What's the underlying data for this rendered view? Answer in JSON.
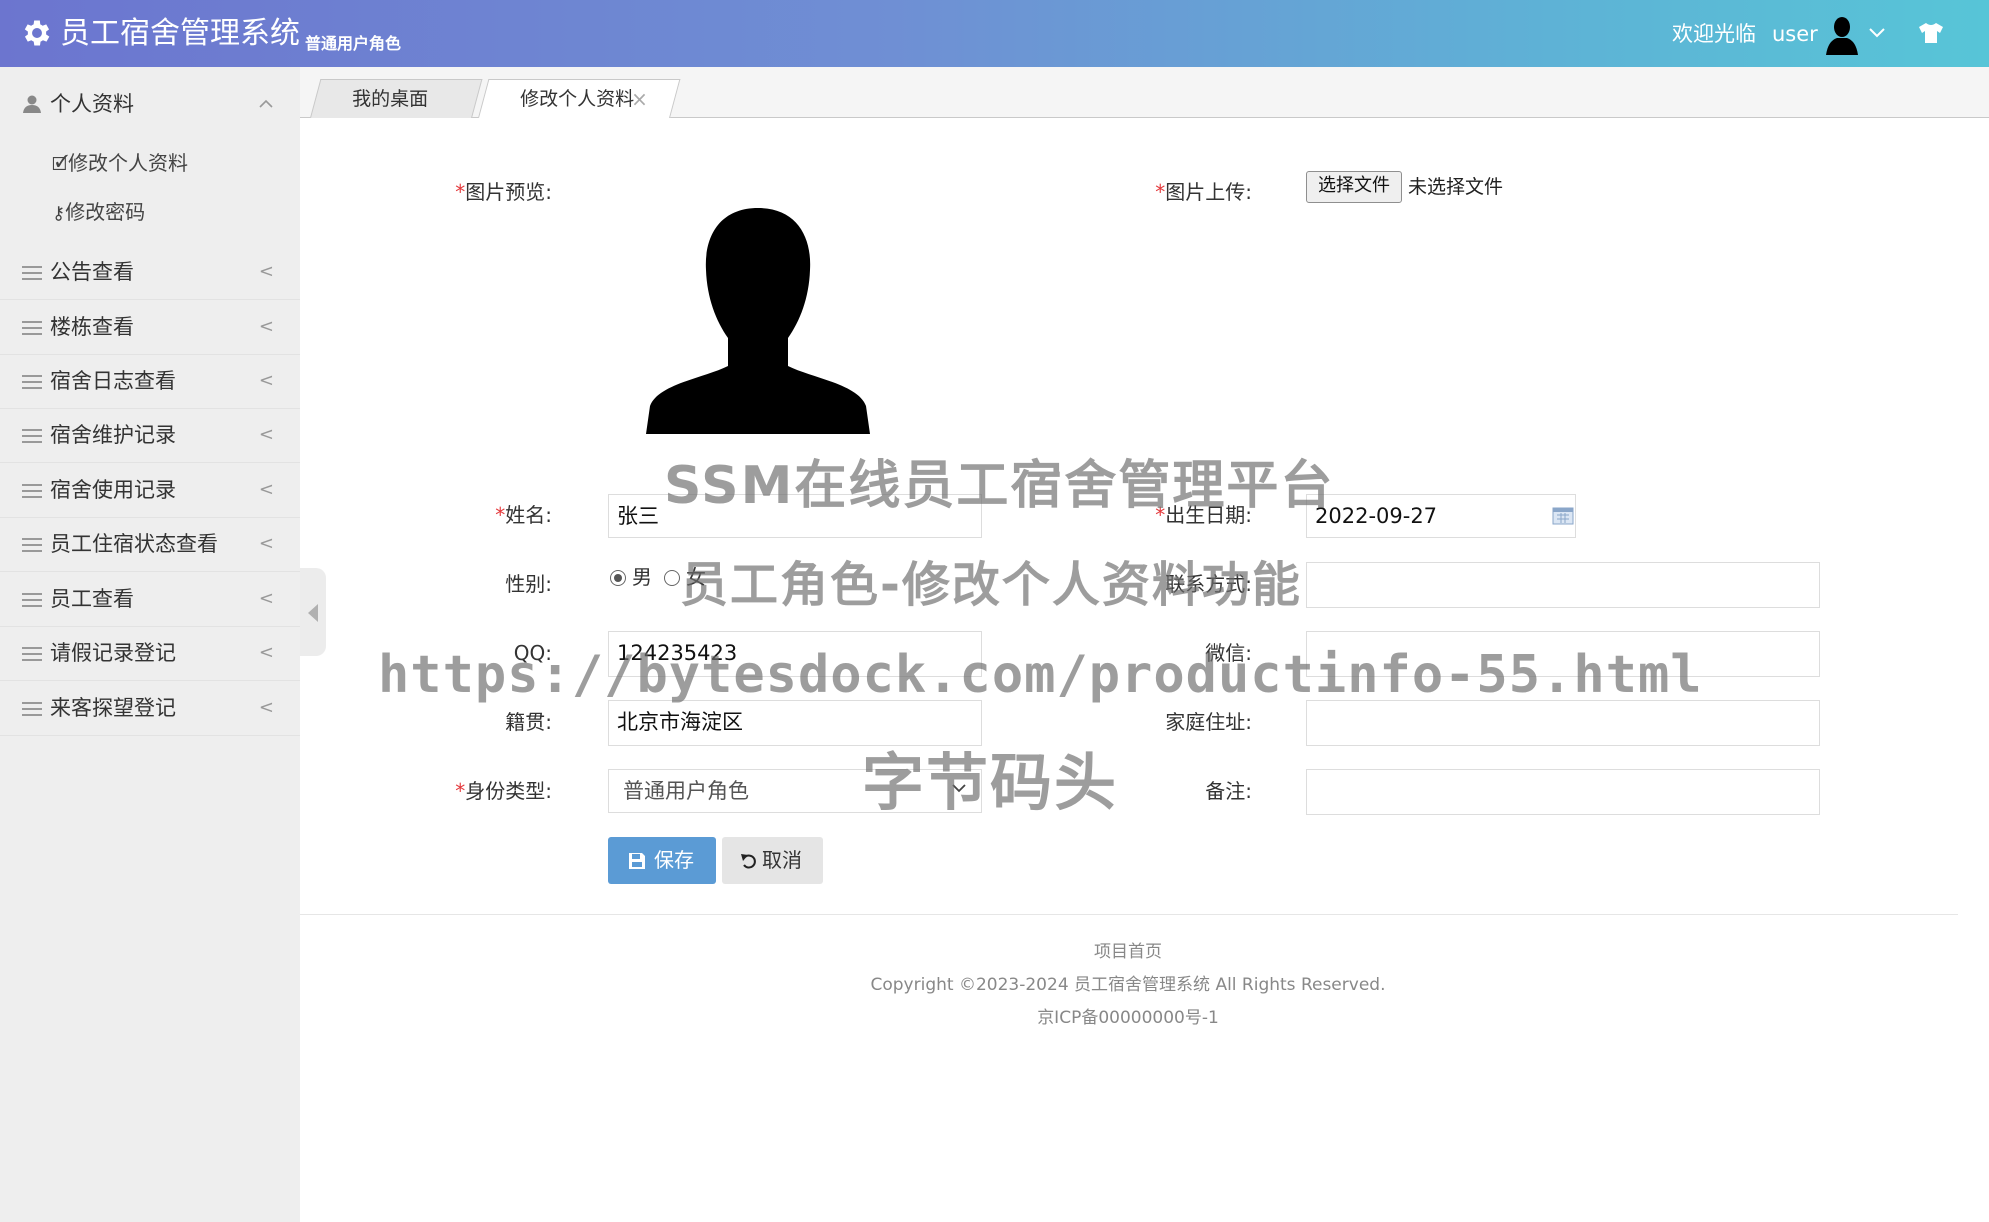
{
  "header": {
    "app_title": "员工宿舍管理系统",
    "role_subtitle": "普通用户角色",
    "welcome": "欢迎光临",
    "username": "user"
  },
  "sidebar": {
    "profile_group": {
      "label": "个人资料",
      "items": [
        {
          "label": "修改个人资料",
          "icon": "edit-icon"
        },
        {
          "label": "修改密码",
          "icon": "key-icon"
        }
      ]
    },
    "items": [
      {
        "label": "公告查看"
      },
      {
        "label": "楼栋查看"
      },
      {
        "label": "宿舍日志查看"
      },
      {
        "label": "宿舍维护记录"
      },
      {
        "label": "宿舍使用记录"
      },
      {
        "label": "员工住宿状态查看"
      },
      {
        "label": "员工查看"
      },
      {
        "label": "请假记录登记"
      },
      {
        "label": "来客探望登记"
      }
    ]
  },
  "tabs": [
    {
      "label": "我的桌面",
      "active": false
    },
    {
      "label": "修改个人资料",
      "active": true
    }
  ],
  "form": {
    "image_preview_label": "图片预览:",
    "image_upload_label": "图片上传:",
    "file_button": "选择文件",
    "file_status": "未选择文件",
    "name_label": "姓名:",
    "name_value": "张三",
    "birth_label": "出生日期:",
    "birth_value": "2022-09-27",
    "gender_label": "性别:",
    "gender_options": [
      "男",
      "女"
    ],
    "gender_selected": "男",
    "contact_label": "联系方式:",
    "contact_value": "",
    "qq_label": "QQ:",
    "qq_value": "124235423",
    "wechat_label": "微信:",
    "wechat_value": "",
    "native_label": "籍贯:",
    "native_value": "北京市海淀区",
    "address_label": "家庭住址:",
    "address_value": "",
    "identity_label": "身份类型:",
    "identity_value": "普通用户角色",
    "remark_label": "备注:",
    "remark_value": "",
    "save_button": "保存",
    "cancel_button": "取消"
  },
  "footer": {
    "home_link": "项目首页",
    "copyright": "Copyright ©2023-2024 员工宿舍管理系统 All Rights Reserved.",
    "icp": "京ICP备00000000号-1"
  },
  "watermark": {
    "line1": "SSM在线员工宿舍管理平台",
    "line2": "员工角色-修改个人资料功能",
    "line3": "https://bytesdock.com/productinfo-55.html",
    "line4": "字节码头"
  },
  "colors": {
    "header_gradient_start": "#6c75cf",
    "header_gradient_end": "#57c5d7",
    "sidebar_bg": "#eeeeee",
    "required_star": "#e4393c",
    "save_button_bg": "#5b9bd5"
  }
}
